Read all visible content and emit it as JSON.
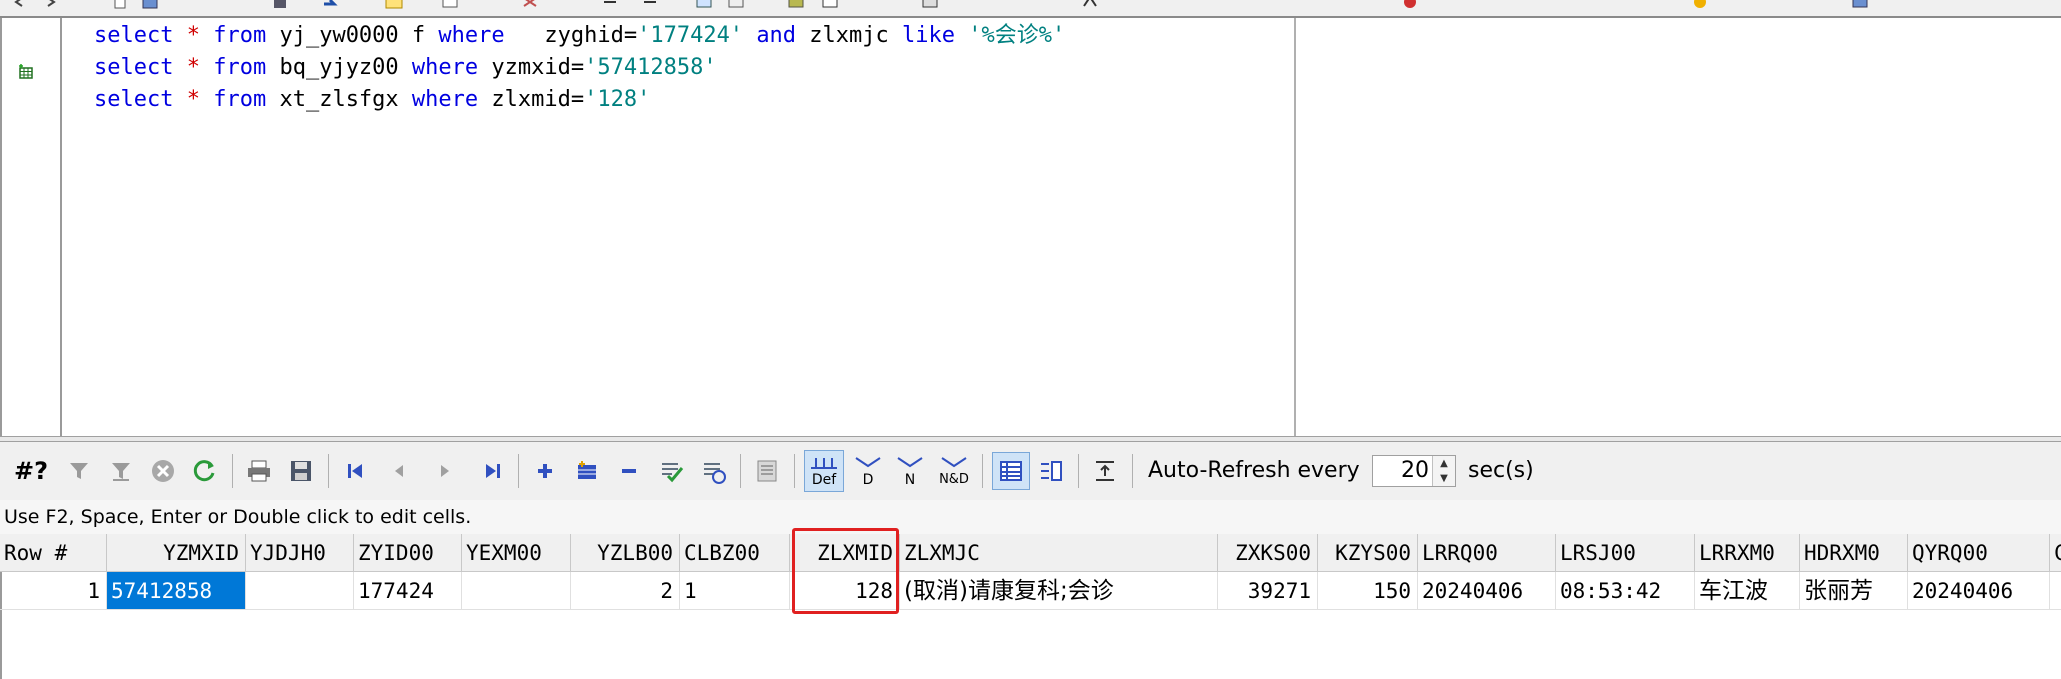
{
  "editor": {
    "lines": [
      [
        {
          "t": "select",
          "c": "kw"
        },
        {
          "t": " ",
          "c": ""
        },
        {
          "t": "*",
          "c": "op"
        },
        {
          "t": " ",
          "c": ""
        },
        {
          "t": "from",
          "c": "kw"
        },
        {
          "t": " yj_yw0000 f ",
          "c": ""
        },
        {
          "t": "where",
          "c": "kw"
        },
        {
          "t": "   zyghid=",
          "c": ""
        },
        {
          "t": "'177424'",
          "c": "str"
        },
        {
          "t": " ",
          "c": ""
        },
        {
          "t": "and",
          "c": "kw"
        },
        {
          "t": " zlxmjc ",
          "c": ""
        },
        {
          "t": "like",
          "c": "kw"
        },
        {
          "t": " ",
          "c": ""
        },
        {
          "t": "'%会诊%'",
          "c": "str"
        }
      ],
      [
        {
          "t": "select",
          "c": "kw"
        },
        {
          "t": " ",
          "c": ""
        },
        {
          "t": "*",
          "c": "op"
        },
        {
          "t": " ",
          "c": ""
        },
        {
          "t": "from",
          "c": "kw"
        },
        {
          "t": " bq_yjyz00 ",
          "c": ""
        },
        {
          "t": "where",
          "c": "kw"
        },
        {
          "t": " yzmxid=",
          "c": ""
        },
        {
          "t": "'57412858'",
          "c": "str"
        }
      ],
      [
        {
          "t": "select",
          "c": "kw"
        },
        {
          "t": " ",
          "c": ""
        },
        {
          "t": "*",
          "c": "op"
        },
        {
          "t": " ",
          "c": ""
        },
        {
          "t": "from",
          "c": "kw"
        },
        {
          "t": " xt_zlsfgx ",
          "c": ""
        },
        {
          "t": "where",
          "c": "kw"
        },
        {
          "t": " zlxmid=",
          "c": ""
        },
        {
          "t": "'128'",
          "c": "str"
        }
      ]
    ]
  },
  "grid_toolbar": {
    "query_label": "#?",
    "auto_refresh_label": "Auto-Refresh every",
    "interval_value": "20",
    "unit_label": "sec(s)",
    "def_label": "Def",
    "d_label": "D",
    "n_label": "N",
    "nd_label": "N&D"
  },
  "hint": "Use F2, Space, Enter or Double click to edit cells.",
  "grid": {
    "columns": [
      {
        "label": "Row #"
      },
      {
        "label": "YZMXID"
      },
      {
        "label": "YJDJH0"
      },
      {
        "label": "ZYID00"
      },
      {
        "label": "YEXM00"
      },
      {
        "label": "YZLB00"
      },
      {
        "label": "CLBZ00"
      },
      {
        "label": "ZLXMID"
      },
      {
        "label": "ZLXMJC"
      },
      {
        "label": "ZXKS00"
      },
      {
        "label": "KZYS00"
      },
      {
        "label": "LRRQ00"
      },
      {
        "label": "LRSJ00"
      },
      {
        "label": "LRRXM0"
      },
      {
        "label": "HDRXM0"
      },
      {
        "label": "QYRQ00"
      },
      {
        "label": "C"
      }
    ],
    "rows": [
      [
        "1",
        "57412858",
        "",
        "177424",
        "",
        "2",
        "1",
        "128",
        "(取消)请康复科;会诊",
        "39271",
        "150",
        "20240406",
        "08:53:42",
        "车江波",
        "张丽芳",
        "20240406",
        ""
      ]
    ]
  },
  "colors": {
    "keyword": "#0000e0",
    "operator": "#d00000",
    "string": "#008080",
    "selection": "#0078d7",
    "highlight_box": "#e02020"
  }
}
